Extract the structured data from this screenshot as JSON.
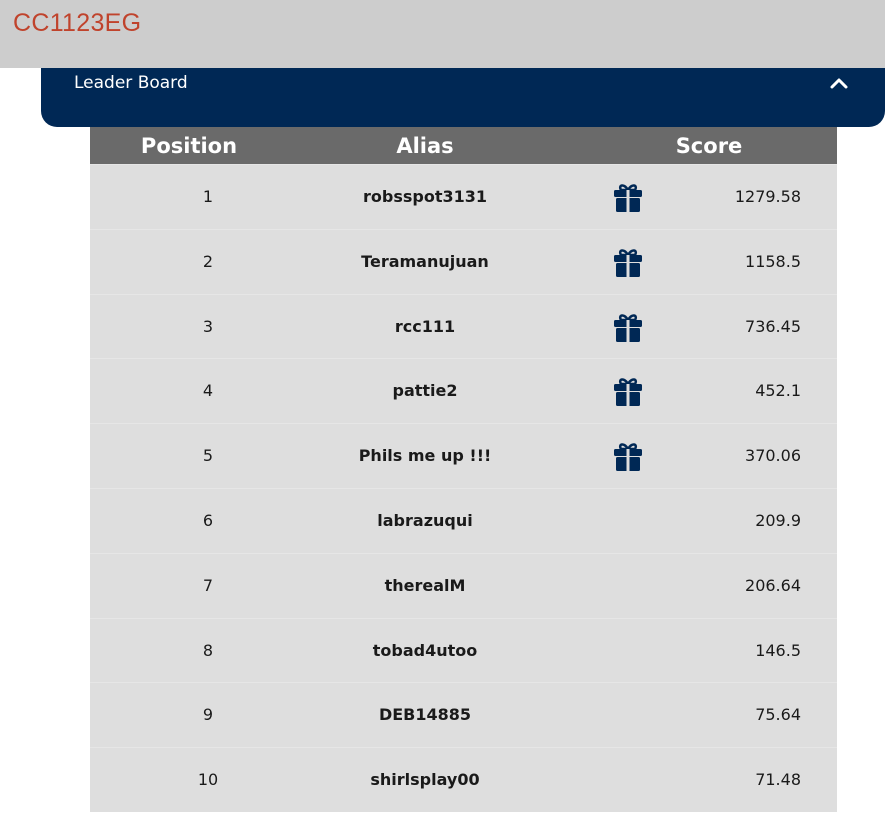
{
  "app": {
    "code": "CC1123EG"
  },
  "panel": {
    "title": "Leader Board"
  },
  "colors": {
    "accent": "#c0432c",
    "header_bg": "#002855",
    "table_header_bg": "#6a6a6a",
    "row_bg": "#dedede"
  },
  "table": {
    "headers": {
      "position": "Position",
      "alias": "Alias",
      "score": "Score"
    },
    "rows": [
      {
        "position": "1",
        "alias": "robsspot3131",
        "score": "1279.58",
        "gift": true
      },
      {
        "position": "2",
        "alias": "Teramanujuan",
        "score": "1158.5",
        "gift": true
      },
      {
        "position": "3",
        "alias": "rcc111",
        "score": "736.45",
        "gift": true
      },
      {
        "position": "4",
        "alias": "pattie2",
        "score": "452.1",
        "gift": true
      },
      {
        "position": "5",
        "alias": "Phils me up !!!",
        "score": "370.06",
        "gift": true
      },
      {
        "position": "6",
        "alias": "labrazuqui",
        "score": "209.9",
        "gift": false
      },
      {
        "position": "7",
        "alias": "therealM",
        "score": "206.64",
        "gift": false
      },
      {
        "position": "8",
        "alias": "tobad4utoo",
        "score": "146.5",
        "gift": false
      },
      {
        "position": "9",
        "alias": "DEB14885",
        "score": "75.64",
        "gift": false
      },
      {
        "position": "10",
        "alias": "shirlsplay00",
        "score": "71.48",
        "gift": false
      }
    ],
    "gift_icon": "gift-icon"
  },
  "toggle_icon": "chevron-up-icon"
}
